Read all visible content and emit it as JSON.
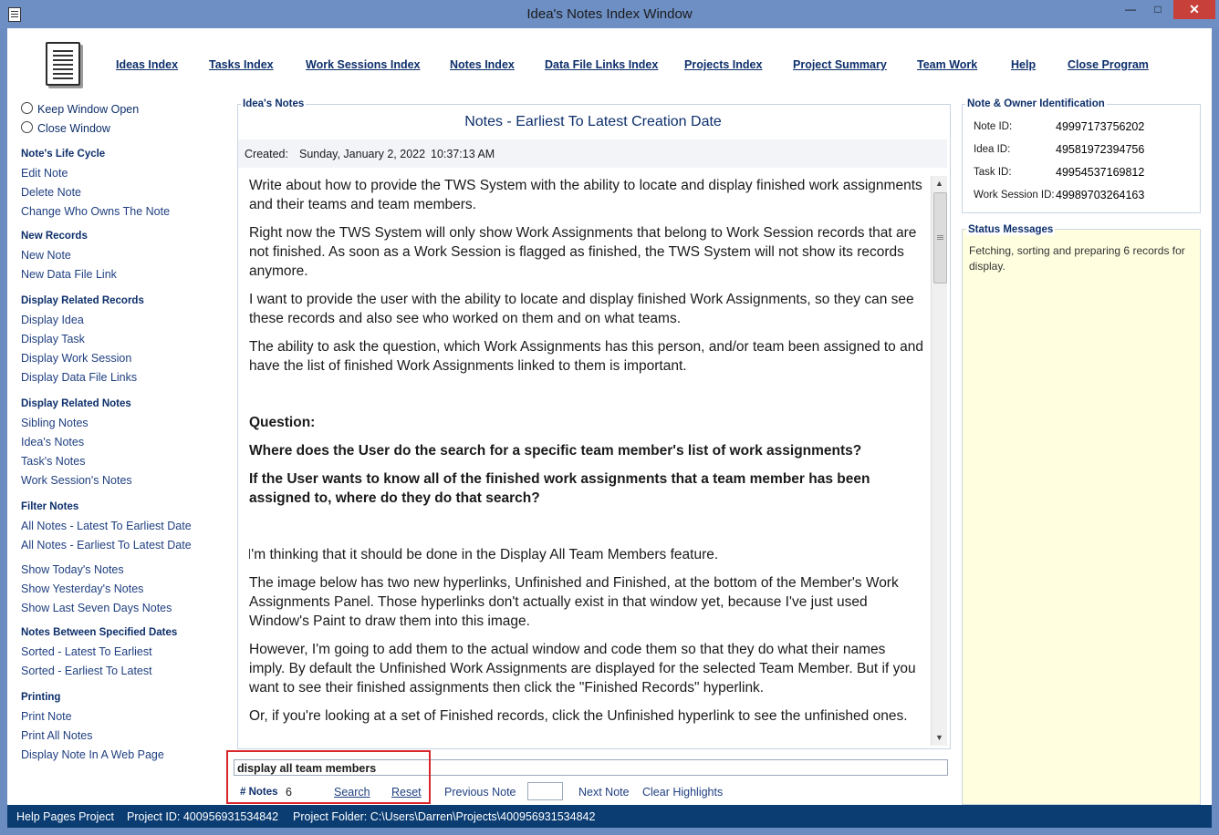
{
  "window": {
    "title": "Idea's Notes Index Window"
  },
  "topnav": [
    "Ideas Index",
    "Tasks Index",
    "Work Sessions Index",
    "Notes Index",
    "Data File Links Index",
    "Projects Index",
    "Project Summary",
    "Team Work",
    "Help",
    "Close Program"
  ],
  "window_options": {
    "keep_open": "Keep Window Open",
    "close": "Close Window"
  },
  "sidebar": {
    "life_cycle": {
      "heading": "Note's Life Cycle",
      "items": [
        "Edit Note",
        "Delete Note",
        "Change Who Owns The Note"
      ]
    },
    "new_records": {
      "heading": "New Records",
      "items": [
        "New Note",
        "New Data File Link"
      ]
    },
    "related_records": {
      "heading": "Display Related Records",
      "items": [
        "Display Idea",
        "Display Task",
        "Display Work Session",
        "Display Data File Links"
      ]
    },
    "related_notes": {
      "heading": "Display Related Notes",
      "items": [
        "Sibling Notes",
        "Idea's Notes",
        "Task's Notes",
        "Work Session's Notes"
      ]
    },
    "filter_notes": {
      "heading": "Filter Notes",
      "items": [
        "All Notes - Latest To Earliest Date",
        "All Notes - Earliest To Latest Date",
        "Show Today's Notes",
        "Show Yesterday's Notes",
        "Show Last Seven Days Notes"
      ]
    },
    "between_dates": {
      "heading": "Notes Between Specified Dates",
      "items": [
        "Sorted - Latest To Earliest",
        "Sorted - Earliest To Latest"
      ]
    },
    "printing": {
      "heading": "Printing",
      "items": [
        "Print Note",
        "Print All Notes",
        "Display Note In A Web Page"
      ]
    }
  },
  "notes_panel": {
    "legend": "Idea's Notes",
    "heading": "Notes - Earliest To Latest Creation Date",
    "created_label": "Created:",
    "created_date": "Sunday, January 2, 2022",
    "created_time": "10:37:13 AM",
    "paragraphs": [
      "Write about how to provide the TWS System with the ability to locate and display finished work assignments and their teams and team members.",
      "Right now the TWS System will only show Work Assignments that belong to Work Session records that are not finished. As soon as a Work Session is flagged as finished, the TWS System will not show its records anymore.",
      "I want to provide the user with the ability to locate and display finished Work Assignments, so they can see these records and also see who worked on them and on what teams.",
      "The ability to ask the question, which Work Assignments has this person, and/or team been assigned to and have the list of finished Work Assignments linked to them is important.",
      "Question:",
      "Where does the User do the search for a specific team member's list of work assignments?",
      "If the User wants to know all of the finished work assignments that a team member has been assigned to, where do they do that search?",
      "I'm thinking that it should be done in the Display All Team Members feature.",
      "The image below has two new hyperlinks, Unfinished and Finished, at the bottom of the Member's Work Assignments Panel. Those hyperlinks don't actually exist in that window yet, because I've just used Window's Paint to draw them into this image.",
      "However, I'm going to add them to the actual window and code them so that they do what their names imply. By default the Unfinished Work Assignments are displayed for the selected Team Member. But if you want to see their finished assignments then click the \"Finished Records\" hyperlink.",
      "Or, if you're looking at a set of Finished records, click the Unfinished hyperlink to see the unfinished ones."
    ]
  },
  "search": {
    "value": "display all team members",
    "notes_count_label": "# Notes",
    "notes_count": "6",
    "search_label": "Search",
    "reset_label": "Reset",
    "previous_label": "Previous Note",
    "next_label": "Next Note",
    "clear_label": "Clear Highlights"
  },
  "identification": {
    "legend": "Note & Owner Identification",
    "note_id_label": "Note ID:",
    "note_id": "49997173756202",
    "idea_id_label": "Idea ID:",
    "idea_id": "49581972394756",
    "task_id_label": "Task ID:",
    "task_id": "49954537169812",
    "session_id_label": "Work Session ID:",
    "session_id": "49989703264163"
  },
  "status_messages": {
    "legend": "Status Messages",
    "text": "Fetching, sorting and preparing 6 records for display."
  },
  "statusbar": {
    "project": "Help Pages Project",
    "project_id": "Project ID:  400956931534842",
    "folder": "Project Folder:  C:\\Users\\Darren\\Projects\\400956931534842"
  },
  "colors": {
    "accent": "#0d2f6b",
    "status_bar": "#0b3d73",
    "status_bg": "#ffffe0",
    "highlight_box": "#d8262a"
  }
}
